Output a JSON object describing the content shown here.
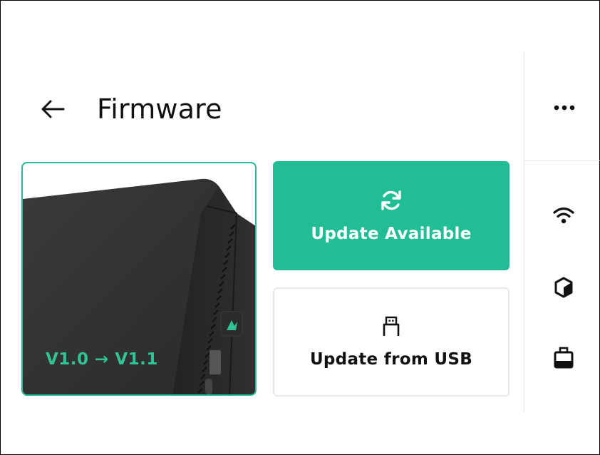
{
  "header": {
    "title": "Firmware"
  },
  "device_card": {
    "version_label": "V1.0 → V1.1"
  },
  "actions": {
    "update_available_label": "Update Available",
    "update_usb_label": "Update from USB"
  },
  "sidebar": {
    "icons": [
      "more-icon",
      "wifi-icon",
      "cube-icon",
      "printer-icon"
    ]
  },
  "colors": {
    "accent": "#21bd94",
    "version_text": "#2fc395",
    "text": "#111111",
    "divider": "#e6e6e6"
  }
}
